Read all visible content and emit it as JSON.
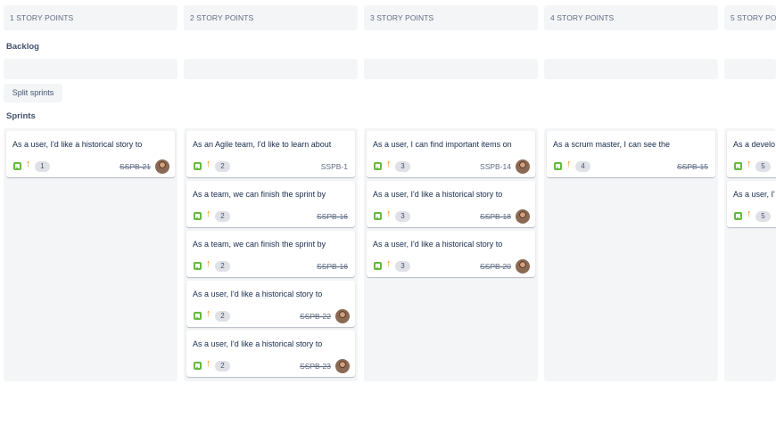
{
  "columns": [
    {
      "header": "1 STORY POINTS"
    },
    {
      "header": "2 STORY POINTS"
    },
    {
      "header": "3 STORY POINTS"
    },
    {
      "header": "4 STORY POINTS"
    },
    {
      "header": "5 STORY POIN"
    }
  ],
  "sections": {
    "backlog": "Backlog",
    "sprints": "Sprints"
  },
  "split_button": "Split sprints",
  "cards": {
    "col1": [
      {
        "summary": "As a user, I'd like a historical story to",
        "points": "1",
        "key": "SSPB-21",
        "done": true,
        "avatar": true
      }
    ],
    "col2": [
      {
        "summary": "As an Agile team, I'd like to learn about",
        "points": "2",
        "key": "SSPB-1",
        "done": false,
        "avatar": false
      },
      {
        "summary": "As a team, we can finish the sprint by",
        "points": "2",
        "key": "SSPB-16",
        "done": true,
        "avatar": false
      },
      {
        "summary": "As a team, we can finish the sprint by",
        "points": "2",
        "key": "SSPB-16",
        "done": true,
        "avatar": false
      },
      {
        "summary": "As a user, I'd like a historical story to",
        "points": "2",
        "key": "SSPB-22",
        "done": true,
        "avatar": true
      },
      {
        "summary": "As a user, I'd like a historical story to",
        "points": "2",
        "key": "SSPB-23",
        "done": true,
        "avatar": true
      }
    ],
    "col3": [
      {
        "summary": "As a user, I can find important items on",
        "points": "3",
        "key": "SSPB-14",
        "done": false,
        "avatar": true
      },
      {
        "summary": "As a user, I'd like a historical story to",
        "points": "3",
        "key": "SSPB-18",
        "done": true,
        "avatar": true
      },
      {
        "summary": "As a user, I'd like a historical story to",
        "points": "3",
        "key": "SSPB-20",
        "done": true,
        "avatar": true
      }
    ],
    "col4": [
      {
        "summary": "As a scrum master, I can see the",
        "points": "4",
        "key": "SSPB-15",
        "done": true,
        "avatar": false
      }
    ],
    "col5": [
      {
        "summary": "As a develo",
        "points": "5"
      },
      {
        "summary": "As a user, I'",
        "points": "5"
      }
    ]
  },
  "colors": {
    "story": "#63ba3c",
    "priority": "#ff8b00",
    "column_bg": "#f4f5f7"
  },
  "icons": {
    "story": "story-icon",
    "priority": "arrow-up-priority-icon",
    "avatar": "user-avatar"
  }
}
